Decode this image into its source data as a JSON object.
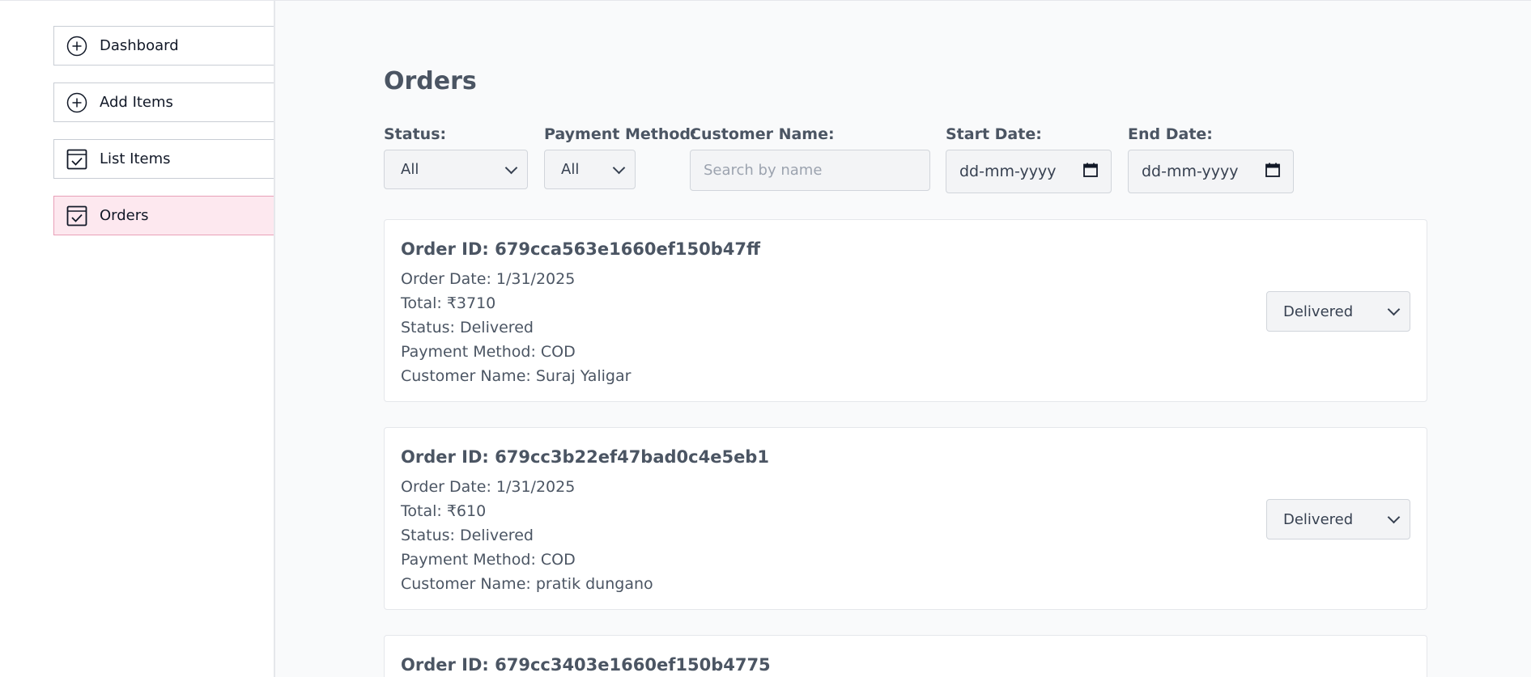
{
  "sidebar": {
    "items": [
      {
        "label": "Dashboard",
        "icon": "plus-circle-icon"
      },
      {
        "label": "Add Items",
        "icon": "plus-circle-icon"
      },
      {
        "label": "List Items",
        "icon": "checkbox-icon"
      },
      {
        "label": "Orders",
        "icon": "checkbox-icon",
        "active": true
      }
    ]
  },
  "main": {
    "title": "Orders",
    "filters": {
      "status": {
        "label": "Status:",
        "value": "All"
      },
      "payment": {
        "label": "Payment Method:",
        "value": "All"
      },
      "customer": {
        "label": "Customer Name:",
        "placeholder": "Search by name"
      },
      "start_date": {
        "label": "Start Date:",
        "placeholder": "dd-mm-yyyy"
      },
      "end_date": {
        "label": "End Date:",
        "placeholder": "dd-mm-yyyy"
      }
    },
    "orders": [
      {
        "id": "Order ID: 679cca563e1660ef150b47ff",
        "date": "Order Date: 1/31/2025",
        "total": "Total: ₹3710",
        "status": "Status: Delivered",
        "payment": "Payment Method: COD",
        "customer": "Customer Name: Suraj Yaligar",
        "select_value": "Delivered"
      },
      {
        "id": "Order ID: 679cc3b22ef47bad0c4e5eb1",
        "date": "Order Date: 1/31/2025",
        "total": "Total: ₹610",
        "status": "Status: Delivered",
        "payment": "Payment Method: COD",
        "customer": "Customer Name: pratik dungano",
        "select_value": "Delivered"
      },
      {
        "id": "Order ID: 679cc3403e1660ef150b4775"
      }
    ]
  },
  "colors": {
    "active_bg": "#fde8ef",
    "active_border": "#e8a0b8"
  }
}
